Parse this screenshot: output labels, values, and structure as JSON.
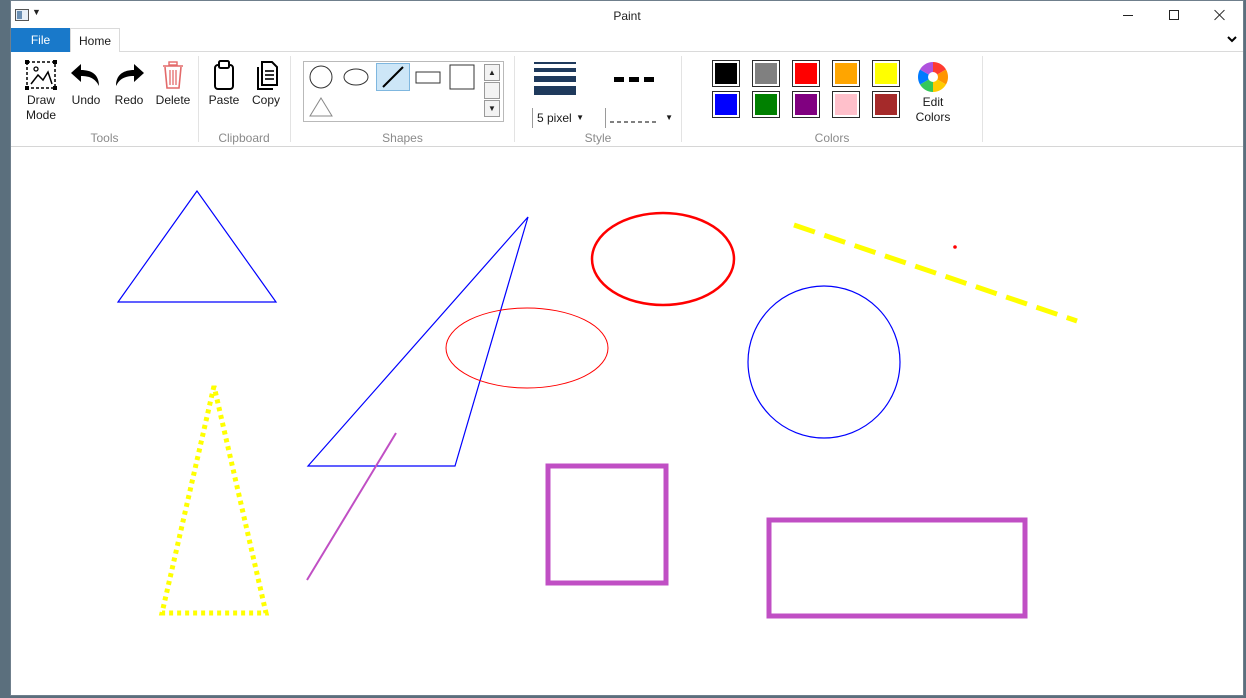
{
  "window": {
    "title": "Paint"
  },
  "tabs": {
    "file": "File",
    "home": "Home"
  },
  "ribbon": {
    "tools": {
      "label": "Tools",
      "draw_mode": "Draw\nMode",
      "undo": "Undo",
      "redo": "Redo",
      "delete": "Delete"
    },
    "clipboard": {
      "label": "Clipboard",
      "paste": "Paste",
      "copy": "Copy"
    },
    "shapes": {
      "label": "Shapes",
      "selected": "line"
    },
    "style": {
      "label": "Style",
      "thickness": "5 pixel",
      "dash_style": "dashed"
    },
    "colors": {
      "label": "Colors",
      "edit_colors": "Edit\nColors",
      "swatches": [
        "#000000",
        "#808080",
        "#ff0000",
        "#ffa500",
        "#ffff00",
        "#0000ff",
        "#008000",
        "#800080",
        "#ffc0cb",
        "#a52a2a"
      ]
    }
  },
  "icons": {
    "draw_mode": "draw-mode-icon",
    "undo": "undo-arrow-icon",
    "redo": "redo-arrow-icon",
    "delete": "trash-icon",
    "paste": "clipboard-icon",
    "copy": "copy-icon",
    "edit_colors": "color-wheel-icon"
  }
}
